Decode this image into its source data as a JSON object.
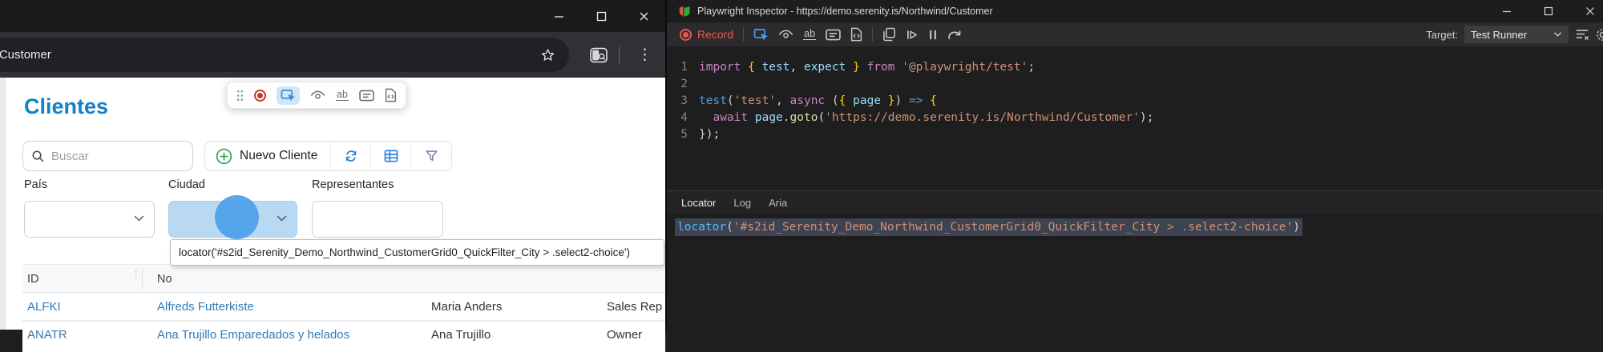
{
  "browser": {
    "url_bar": {
      "url_text": "nd/Customer"
    },
    "window_controls": [
      "minimize",
      "maximize",
      "close"
    ],
    "page": {
      "heading": "Clientes",
      "search": {
        "placeholder": "Buscar"
      },
      "toolbar": {
        "new_customer_label": "Nuevo Cliente",
        "icons": [
          "plus-circle-icon",
          "refresh-icon",
          "column-grid-icon",
          "filter-funnel-icon"
        ]
      },
      "filters": {
        "country_label": "País",
        "city_label": "Ciudad",
        "representatives_label": "Representantes"
      },
      "locator_tooltip": "locator('#s2id_Serenity_Demo_Northwind_CustomerGrid0_QuickFilter_City > .select2-choice')",
      "grid": {
        "headers": [
          "ID",
          "No"
        ],
        "rows": [
          {
            "id": "ALFKI",
            "company": "Alfreds Futterkiste",
            "contact": "Maria Anders",
            "title": "Sales Rep"
          },
          {
            "id": "ANATR",
            "company": "Ana Trujillo Emparedados y helados",
            "contact": "Ana Trujillo",
            "title": "Owner"
          }
        ]
      }
    },
    "pw_overlay_toolbar": {
      "icons": [
        "drag-handle-icon",
        "record-icon",
        "pick-locator-icon",
        "assert-visibility-icon",
        "assert-text-icon",
        "assert-value-icon",
        "assert-snapshot-icon"
      ]
    }
  },
  "inspector": {
    "window_title": "Playwright Inspector - https://demo.serenity.is/Northwind/Customer",
    "toolbar": {
      "record_label": "Record",
      "target_label": "Target:",
      "target_value": "Test Runner",
      "icons": [
        "record-icon",
        "pick-locator-icon",
        "assert-visibility-icon",
        "assert-text-icon",
        "assert-value-icon",
        "assert-snapshot-icon",
        "copy-icon",
        "resume-icon",
        "pause-icon",
        "step-over-icon",
        "clear-icon"
      ]
    },
    "code": {
      "lines": [
        {
          "n": "1",
          "tokens": [
            [
              "import ",
              "kw"
            ],
            [
              "{ ",
              "br"
            ],
            [
              "test",
              "vr"
            ],
            [
              ", ",
              "pu"
            ],
            [
              "expect",
              "vr"
            ],
            [
              " ",
              "pu"
            ],
            [
              "} ",
              "br"
            ],
            [
              "from ",
              "kw"
            ],
            [
              "'@playwright/test'",
              "st"
            ],
            [
              ";",
              "pu"
            ]
          ]
        },
        {
          "n": "2",
          "tokens": []
        },
        {
          "n": "3",
          "tokens": [
            [
              "test",
              "fb"
            ],
            [
              "(",
              "pu"
            ],
            [
              "'test'",
              "st"
            ],
            [
              ", ",
              "pu"
            ],
            [
              "async ",
              "kw"
            ],
            [
              "(",
              "pu"
            ],
            [
              "{ ",
              "br"
            ],
            [
              "page",
              "vr"
            ],
            [
              " ",
              "pu"
            ],
            [
              "}",
              "br"
            ],
            [
              ") ",
              "pu"
            ],
            [
              "=> ",
              "fb"
            ],
            [
              "{",
              "br"
            ]
          ]
        },
        {
          "n": "4",
          "tokens": [
            [
              "  ",
              "pu"
            ],
            [
              "await ",
              "kw"
            ],
            [
              "page",
              "vr"
            ],
            [
              ".",
              "pu"
            ],
            [
              "goto",
              "fn"
            ],
            [
              "(",
              "pu"
            ],
            [
              "'https://demo.serenity.is/Northwind/Customer'",
              "st"
            ],
            [
              ");",
              "pu"
            ]
          ]
        },
        {
          "n": "5",
          "tokens": [
            [
              "});",
              "pu"
            ]
          ]
        }
      ]
    },
    "tabs": [
      {
        "label": "Locator",
        "active": true
      },
      {
        "label": "Log",
        "active": false
      },
      {
        "label": "Aria",
        "active": false
      }
    ],
    "locator_panel": {
      "tokens": [
        [
          "locator",
          "lc"
        ],
        [
          "(",
          "pu"
        ],
        [
          "'#s2id_Serenity_Demo_Northwind_CustomerGrid0_QuickFilter_City > .select2-choice'",
          "st"
        ],
        [
          ")",
          "pu"
        ]
      ]
    }
  },
  "colors": {
    "record_red": "#ef564e",
    "pick_blue": "#4a9df8",
    "heading_blue": "#1480c6",
    "link_blue": "#337ab7",
    "highlight_fill": "#b9d9f2",
    "highlight_dot": "#4da0e8",
    "string_orange": "#ce9178",
    "keyword_purple": "#c586c0"
  }
}
